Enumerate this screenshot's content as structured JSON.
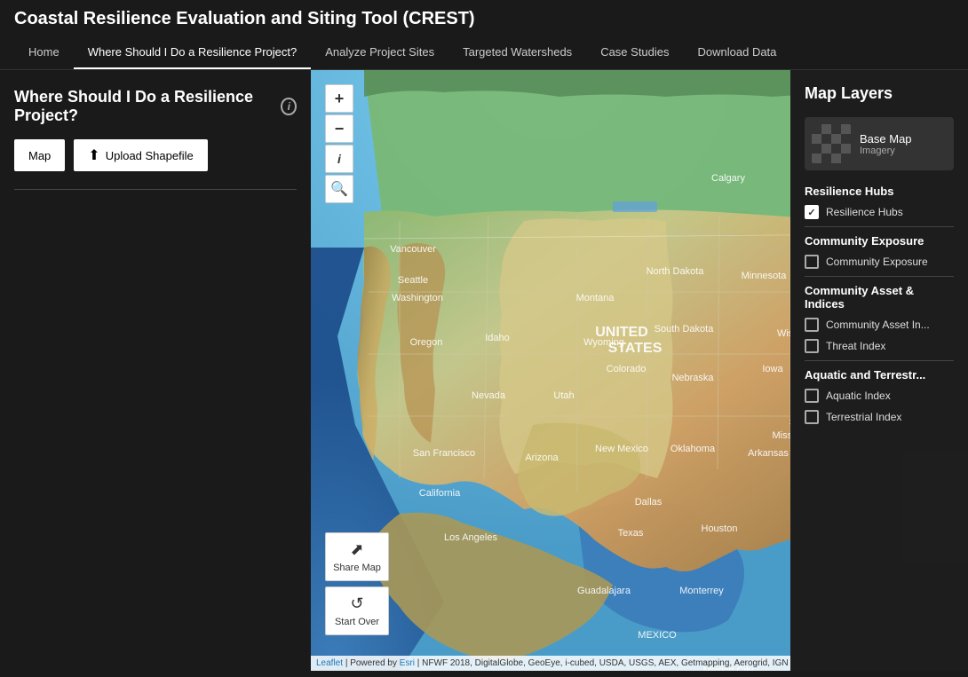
{
  "header": {
    "title": "Coastal Resilience Evaluation and Siting Tool (CREST)",
    "nav": [
      {
        "label": "Home",
        "active": false
      },
      {
        "label": "Where Should I Do a Resilience Project?",
        "active": true
      },
      {
        "label": "Analyze Project Sites",
        "active": false
      },
      {
        "label": "Targeted Watersheds",
        "active": false
      },
      {
        "label": "Case Studies",
        "active": false
      },
      {
        "label": "Download Data",
        "active": false
      }
    ]
  },
  "sidebar": {
    "title": "Where Should I Do a Resilience Project?",
    "buttons": [
      {
        "label": "Map",
        "icon": ""
      },
      {
        "label": "Upload Shapefile",
        "icon": "⬆"
      }
    ]
  },
  "map_controls": {
    "zoom_in": "+",
    "zoom_out": "−",
    "info": "i",
    "search": "🔍"
  },
  "map_actions": [
    {
      "label": "Share Map",
      "icon": "⎇"
    },
    {
      "label": "Start Over",
      "icon": "↺"
    }
  ],
  "map_attribution": "Leaflet | Powered by Esri | NFWF 2018, DigitalGlobe, GeoEye, i-cubed, USDA, USGS, AEX, Getmapping, Aerogrid, IGN",
  "layers_panel": {
    "title": "Map Layers",
    "basemap": {
      "label": "Base Map",
      "sublabel": "Imagery"
    },
    "sections": [
      {
        "title": "Resilience Hubs",
        "items": [
          {
            "label": "Resilience Hubs",
            "checked": true
          }
        ]
      },
      {
        "title": "Community Exposure",
        "items": [
          {
            "label": "Community Exposure",
            "checked": false
          }
        ]
      },
      {
        "title": "Community Asset & Indices",
        "items": [
          {
            "label": "Community Asset In...",
            "checked": false
          },
          {
            "label": "Threat Index",
            "checked": false
          }
        ]
      },
      {
        "title": "Aquatic and Terrestr...",
        "items": [
          {
            "label": "Aquatic Index",
            "checked": false
          },
          {
            "label": "Terrestrial Index",
            "checked": false
          }
        ]
      }
    ]
  },
  "colors": {
    "bg": "#1a1a1a",
    "active_nav_border": "#ffffff",
    "panel_bg": "#1e1e1e"
  }
}
